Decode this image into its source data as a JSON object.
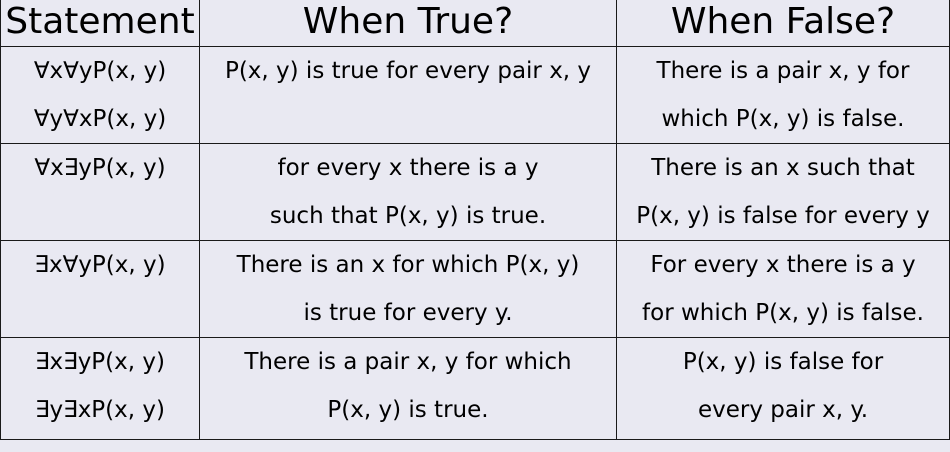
{
  "table": {
    "headers": [
      "Statement",
      "When True?",
      "When False?"
    ],
    "rows": [
      {
        "statement": [
          "∀x∀yP(x, y)",
          "∀y∀xP(x, y)"
        ],
        "when_true": [
          "P(x, y) is true for every pair x, y",
          ""
        ],
        "when_false": [
          "There is a pair x, y for",
          "which P(x, y) is false."
        ]
      },
      {
        "statement": [
          "∀x∃yP(x, y)",
          ""
        ],
        "when_true": [
          "for every x there is a y",
          "such that P(x, y) is true."
        ],
        "when_false": [
          "There is an x such that",
          "P(x, y) is false for every y"
        ]
      },
      {
        "statement": [
          "∃x∀yP(x, y)",
          ""
        ],
        "when_true": [
          "There is an x for which P(x, y)",
          "is true for every y."
        ],
        "when_false": [
          "For every x there is a y",
          "for which P(x, y) is false."
        ]
      },
      {
        "statement": [
          "∃x∃yP(x, y)",
          "∃y∃xP(x, y)"
        ],
        "when_true": [
          "There is a pair x, y for which",
          "P(x, y) is true."
        ],
        "when_false": [
          "P(x, y) is false for",
          "every pair x, y."
        ]
      }
    ]
  }
}
